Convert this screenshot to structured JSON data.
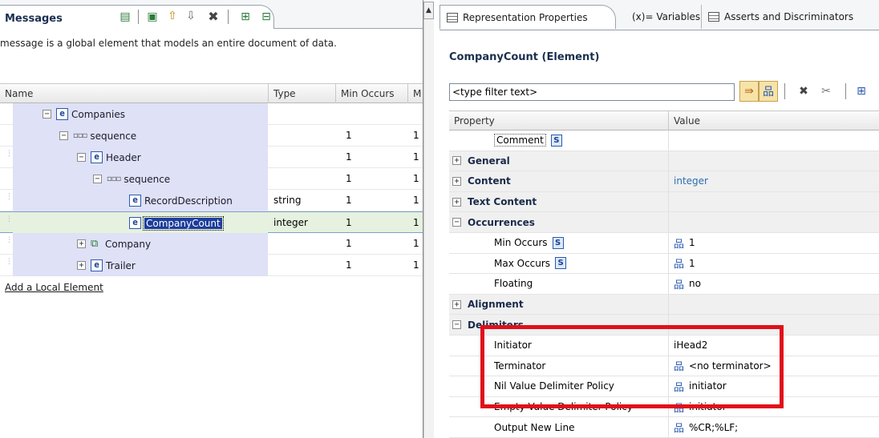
{
  "left": {
    "tab_title": "Messages",
    "description": "message is a global element that models an entire document of data.",
    "columns": {
      "name": "Name",
      "type": "Type",
      "min_occurs": "Min Occurs",
      "max_occurs": "M"
    },
    "rows": [
      {
        "label": "Companies",
        "type": "",
        "min": "",
        "max": ""
      },
      {
        "label": "sequence",
        "type": "",
        "min": "1",
        "max": "1"
      },
      {
        "label": "Header",
        "type": "",
        "min": "1",
        "max": "1"
      },
      {
        "label": "sequence",
        "type": "",
        "min": "1",
        "max": "1"
      },
      {
        "label": "RecordDescription",
        "type": "string",
        "min": "1",
        "max": "1"
      },
      {
        "label": "CompanyCount",
        "type": "integer",
        "min": "1",
        "max": "1"
      },
      {
        "label": "Company",
        "type": "",
        "min": "1",
        "max": "1"
      },
      {
        "label": "Trailer",
        "type": "",
        "min": "1",
        "max": "1"
      }
    ],
    "add_local_element": "Add a Local Element"
  },
  "right": {
    "tabs": {
      "representation": "Representation Properties",
      "variables": "(x)= Variables",
      "asserts": "Asserts and Discriminators"
    },
    "element_title": "CompanyCount (Element)",
    "filter_placeholder": "<type filter text>",
    "columns": {
      "property": "Property",
      "value": "Value"
    },
    "rows": {
      "comment": "Comment",
      "general": "General",
      "content": "Content",
      "content_value": "integer",
      "text_content": "Text Content",
      "occurrences": "Occurrences",
      "min_occurs": "Min Occurs",
      "min_occurs_value": "1",
      "max_occurs": "Max Occurs",
      "max_occurs_value": "1",
      "floating": "Floating",
      "floating_value": "no",
      "alignment": "Alignment",
      "delimiters": "Delimiters",
      "initiator": "Initiator",
      "initiator_value": "iHead2",
      "terminator": "Terminator",
      "terminator_value": "<no terminator>",
      "nil_value_policy": "Nil Value Delimiter Policy",
      "nil_value_policy_value": "initiator",
      "empty_value_policy": "Empty Value Delimiter Policy",
      "empty_value_policy_value": "initiator",
      "output_new_line": "Output New Line",
      "output_new_line_value": "%CR;%LF;"
    },
    "s_badge": "S"
  },
  "icons": {
    "element_badge": "e",
    "highlight_color": "#e0101a",
    "selection_color": "#1c3d9c"
  }
}
